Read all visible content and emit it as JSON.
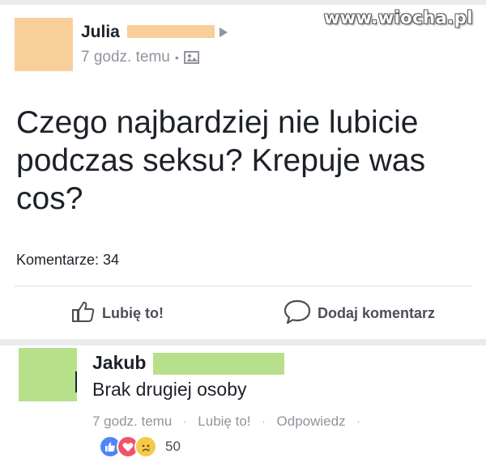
{
  "watermark": "www.wiocha.pl",
  "post": {
    "author_name": "Julia",
    "time": "7 godz. temu",
    "meta_separator": "•",
    "text": "Czego najbardziej nie lubicie podczas seksu? Krepuje was cos?",
    "comments_count": "Komentarze: 34",
    "actions": {
      "like_label": "Lubię to!",
      "comment_label": "Dodaj komentarz"
    }
  },
  "comment": {
    "author_name": "Jakub",
    "text": "Brak drugiej osoby",
    "time": "7 godz. temu",
    "like_label": "Lubię to!",
    "reply_label": "Odpowiedz",
    "separator": "·",
    "reactions_count": "50",
    "reactions": [
      "like-icon",
      "love-icon",
      "sad-icon"
    ]
  },
  "colors": {
    "redaction_post": "#f8cf9a",
    "redaction_comment": "#b7e08a",
    "meta_gray": "#90949c",
    "text_dark": "#1d2129"
  }
}
